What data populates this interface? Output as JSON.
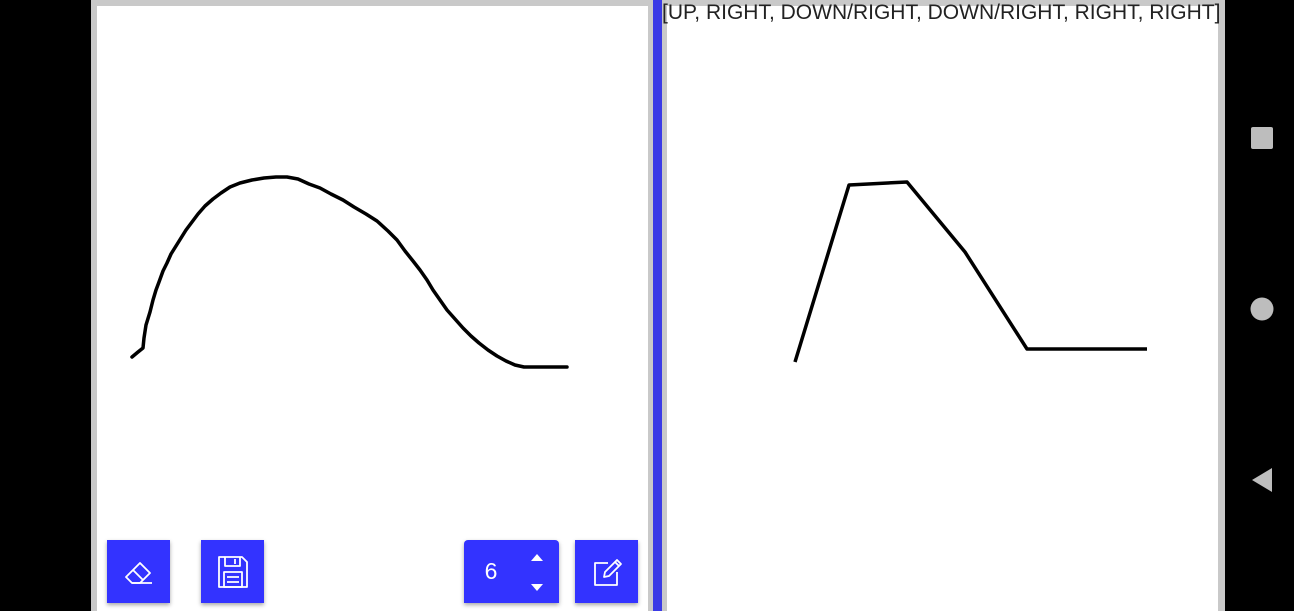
{
  "recognized_directions": "[UP, RIGHT, DOWN/RIGHT, DOWN/RIGHT, RIGHT, RIGHT]",
  "toolbar": {
    "eraser_icon": "eraser-icon",
    "save_icon": "floppy-disk-icon",
    "edit_icon": "pencil-square-icon"
  },
  "stepper": {
    "value": "6",
    "up_icon": "triangle-up-icon",
    "down_icon": "triangle-down-icon"
  },
  "navigation": {
    "recents_icon": "square-icon",
    "home_icon": "circle-icon",
    "back_icon": "triangle-left-icon"
  },
  "colors": {
    "accent": "#3333ff",
    "divider": "#3a3ae6",
    "stroke": "#000000",
    "canvas": "#ffffff"
  }
}
